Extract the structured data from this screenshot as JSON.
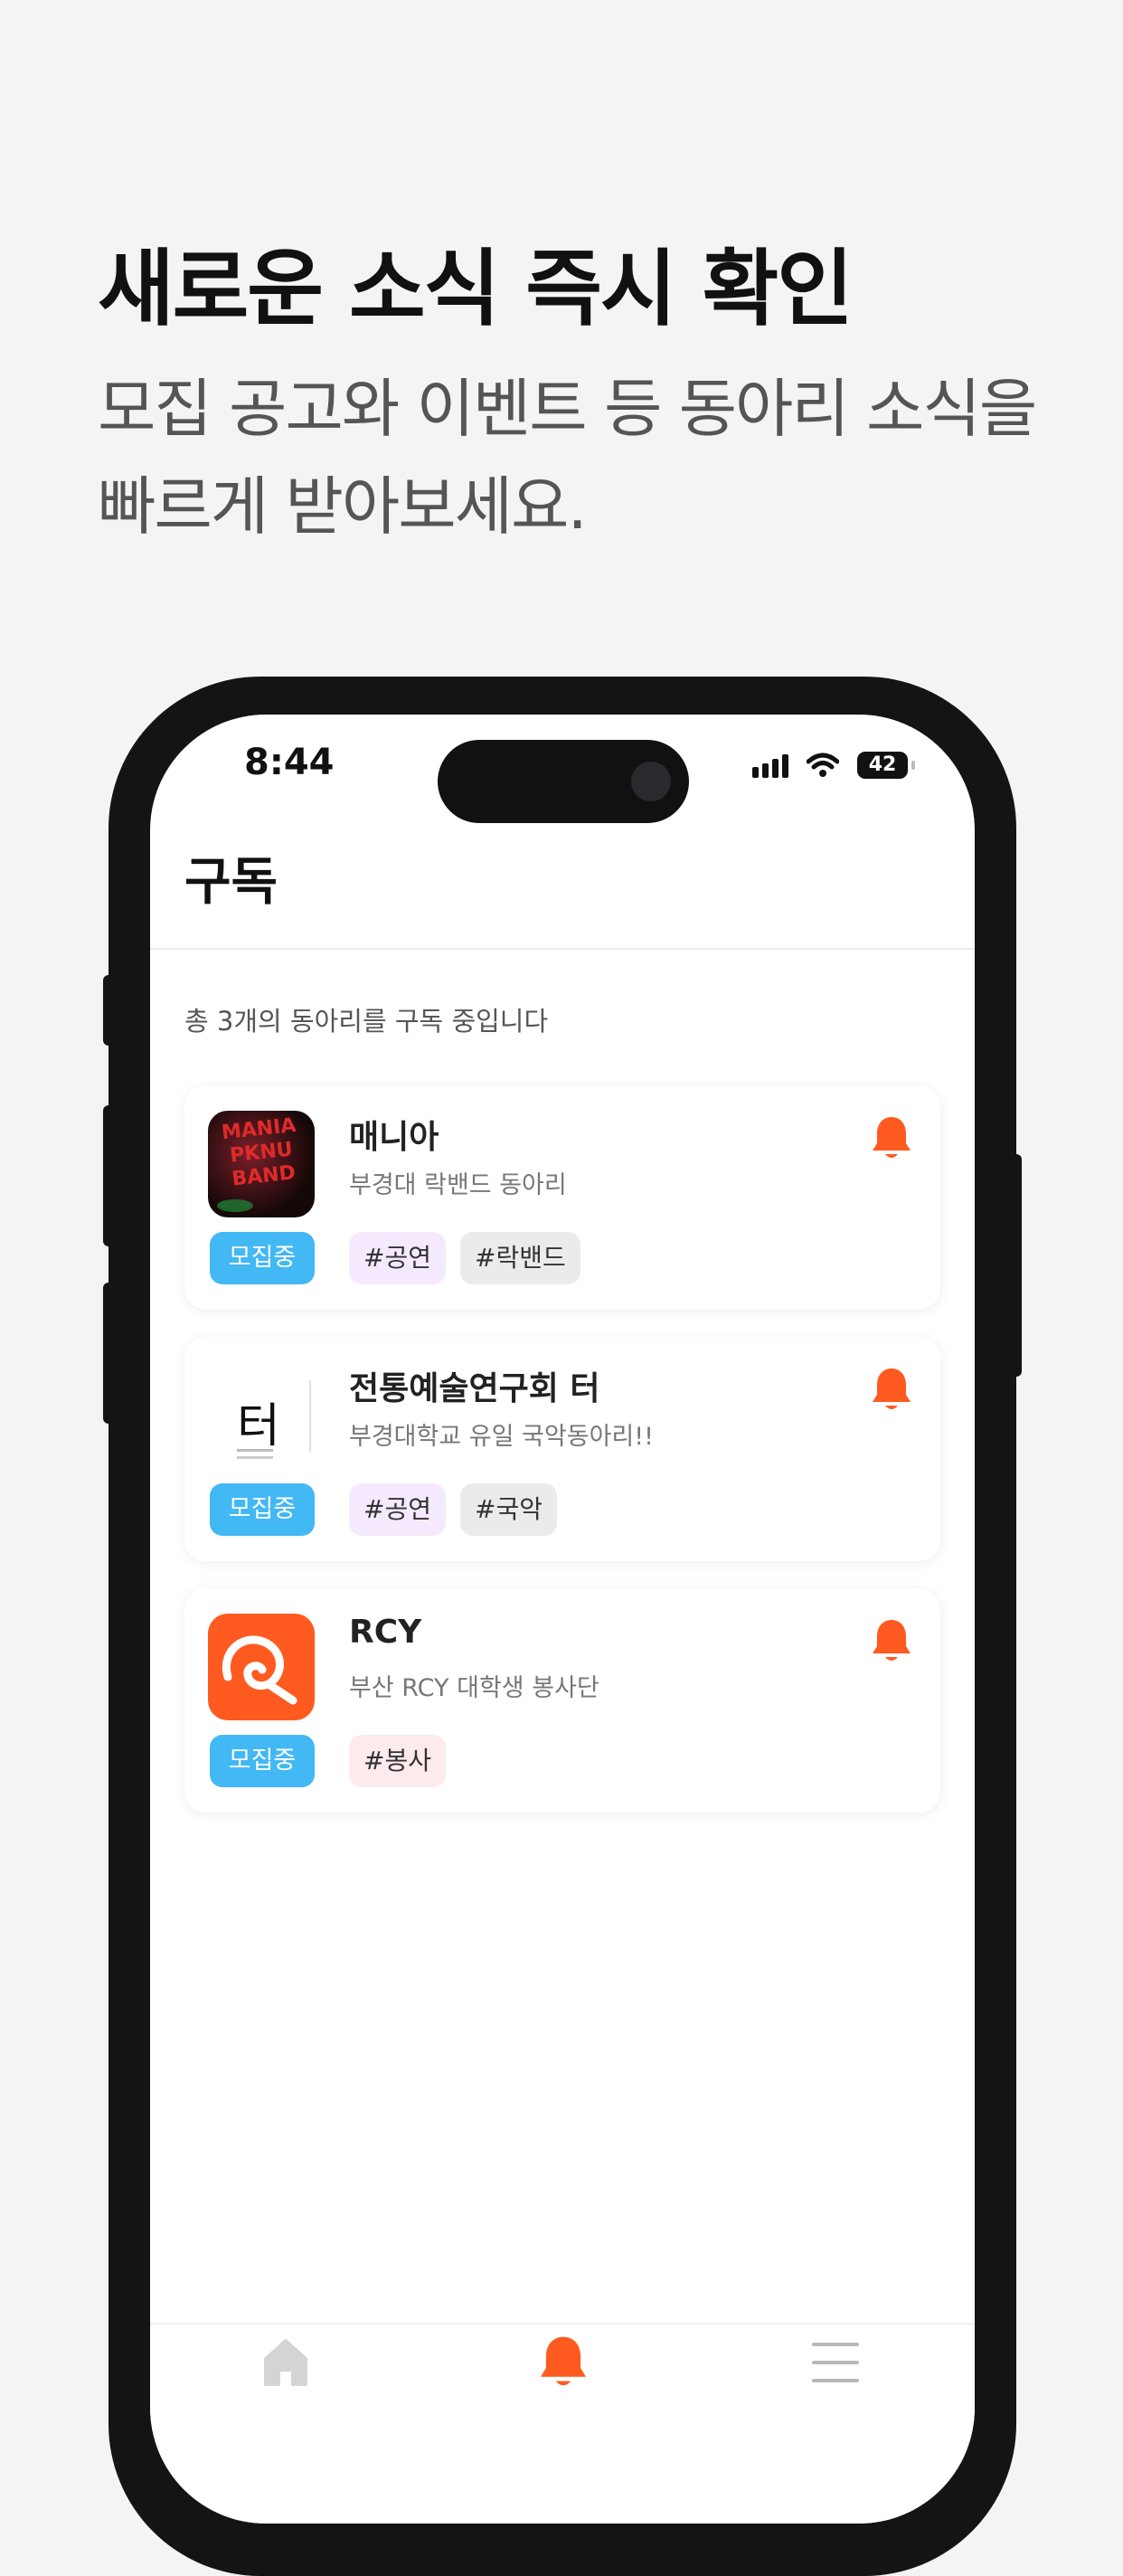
{
  "headline": "새로운 소식 즉시 확인",
  "subline": "모집 공고와 이벤트 등 동아리 소식을 빠르게 받아보세요.",
  "status_bar": {
    "time": "8:44",
    "battery": "42"
  },
  "page": {
    "title": "구독",
    "summary": "총 3개의 동아리를 구독 중입니다"
  },
  "clubs": [
    {
      "name": "매니아",
      "description": "부경대 락밴드 동아리",
      "status": "모집중",
      "tags": [
        "#공연",
        "#락밴드"
      ],
      "logo_text": [
        "MANIA",
        "PKNU",
        "BAND"
      ]
    },
    {
      "name": "전통예술연구회 터",
      "description": "부경대학교 유일 국악동아리!!",
      "status": "모집중",
      "tags": [
        "#공연",
        "#국악"
      ],
      "logo_text": [
        "터"
      ]
    },
    {
      "name": "RCY",
      "description": "부산 RCY 대학생 봉사단",
      "status": "모집중",
      "tags": [
        "#봉사"
      ]
    }
  ],
  "tab_bar": {
    "items": [
      "home-icon",
      "bell-icon",
      "menu-icon"
    ],
    "active": "bell-icon"
  },
  "colors": {
    "accent": "#ff5a1f",
    "recruiting": "#42b8f5",
    "background": "#f4f4f5"
  }
}
